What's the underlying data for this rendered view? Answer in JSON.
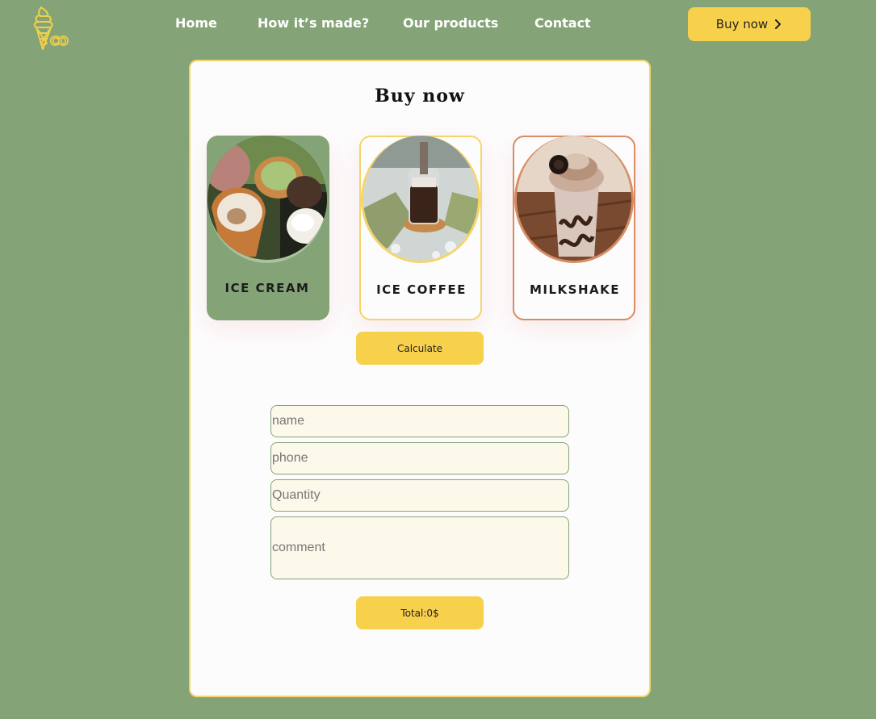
{
  "header": {
    "logo_icon": "ice-cream-cone-logo",
    "logo_text": "CO",
    "nav": [
      {
        "label": "Home"
      },
      {
        "label": "How it’s made?"
      },
      {
        "label": "Our products"
      },
      {
        "label": "Contact"
      }
    ],
    "buy_now_label": "Buy now",
    "buy_now_icon": "chevron-right-icon"
  },
  "card": {
    "title": "Buy now",
    "products": [
      {
        "name": "ICE CREAM",
        "image": "ice-cream-waffle-cones-photo",
        "accent": "#84a477"
      },
      {
        "name": "ICE COFFEE",
        "image": "iced-coffee-glass-photo",
        "accent": "#f3d56a"
      },
      {
        "name": "MILKSHAKE",
        "image": "milkshake-cup-photo",
        "accent": "#d98c63"
      }
    ],
    "calculate_label": "Calculate",
    "form": {
      "name_placeholder": "name",
      "phone_placeholder": "phone",
      "quantity_placeholder": "Quantity",
      "comment_placeholder": "comment"
    },
    "total_label": "Total:0$"
  },
  "colors": {
    "background": "#84a477",
    "accent_yellow": "#f8d14c",
    "card_border": "#f3d56a",
    "milkshake_border": "#d98c63",
    "input_bg": "#fcf8ea"
  }
}
